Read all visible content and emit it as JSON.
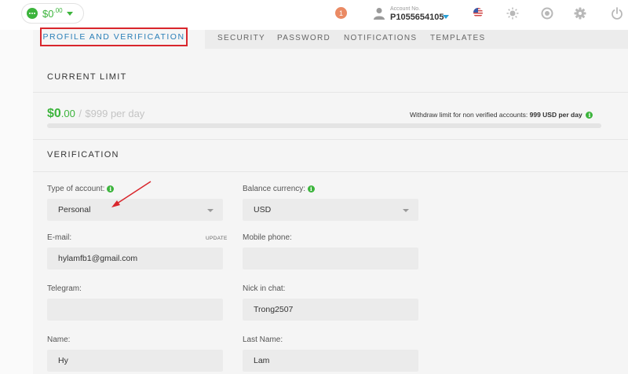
{
  "header": {
    "balance_main": "$0",
    "balance_cents": ".00",
    "notification_count": "1",
    "account_label": "Account No.",
    "account_number": "P1055654105"
  },
  "tabs": [
    {
      "label": "PROFILE AND VERIFICATION",
      "active": true
    },
    {
      "label": "SECURITY",
      "active": false
    },
    {
      "label": "PASSWORD",
      "active": false
    },
    {
      "label": "NOTIFICATIONS",
      "active": false
    },
    {
      "label": "TEMPLATES",
      "active": false
    }
  ],
  "current_limit": {
    "title": "CURRENT LIMIT",
    "used_main": "$0",
    "used_cents": ".00",
    "separator": "/",
    "max": "$999 per day",
    "note_prefix": "Withdraw limit for non verified accounts:",
    "note_value": "999 USD per day",
    "progress_fraction": 0
  },
  "verification": {
    "title": "VERIFICATION",
    "update_label": "UPDATE",
    "fields": {
      "account_type": {
        "label": "Type of account:",
        "value": "Personal"
      },
      "currency": {
        "label": "Balance currency:",
        "value": "USD"
      },
      "email": {
        "label": "E-mail:",
        "value": "hylamfb1@gmail.com"
      },
      "phone": {
        "label": "Mobile phone:",
        "value": ""
      },
      "telegram": {
        "label": "Telegram:",
        "value": ""
      },
      "nick": {
        "label": "Nick in chat:",
        "value": "Trong2507"
      },
      "name": {
        "label": "Name:",
        "value": "Hy"
      },
      "last_name": {
        "label": "Last Name:",
        "value": "Lam"
      }
    }
  },
  "icons": {
    "wallet": "wallet-icon",
    "user": "user-icon",
    "flag": "us-flag-icon",
    "theme": "sun-icon",
    "support": "support-icon",
    "settings": "gear-icon",
    "logout": "power-icon",
    "info": "info-icon"
  },
  "colors": {
    "accent_green": "#3cb43c",
    "tab_active_text": "#2a7fb8",
    "highlight_red": "#d9262c",
    "badge_orange": "#ea8a64",
    "caret_blue": "#2a9fd6"
  }
}
